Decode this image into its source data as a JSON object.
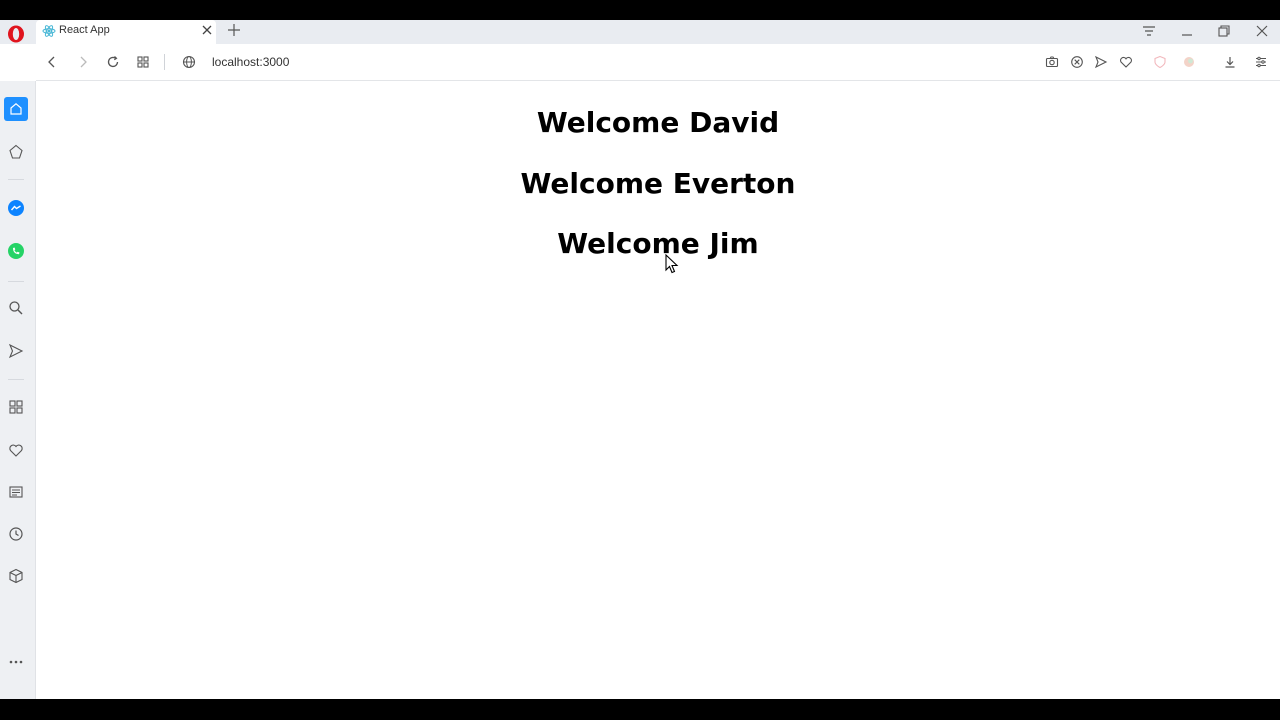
{
  "browser": {
    "tab": {
      "title": "React App",
      "favicon": "react-icon"
    },
    "address": {
      "url": "localhost:3000"
    },
    "colors": {
      "opera_red": "#e0141e",
      "active_blue": "#1e90ff",
      "messenger": "#0d84ff",
      "whatsapp": "#25d366"
    }
  },
  "page": {
    "greetings": [
      "Welcome David",
      "Welcome Everton",
      "Welcome Jim"
    ]
  }
}
